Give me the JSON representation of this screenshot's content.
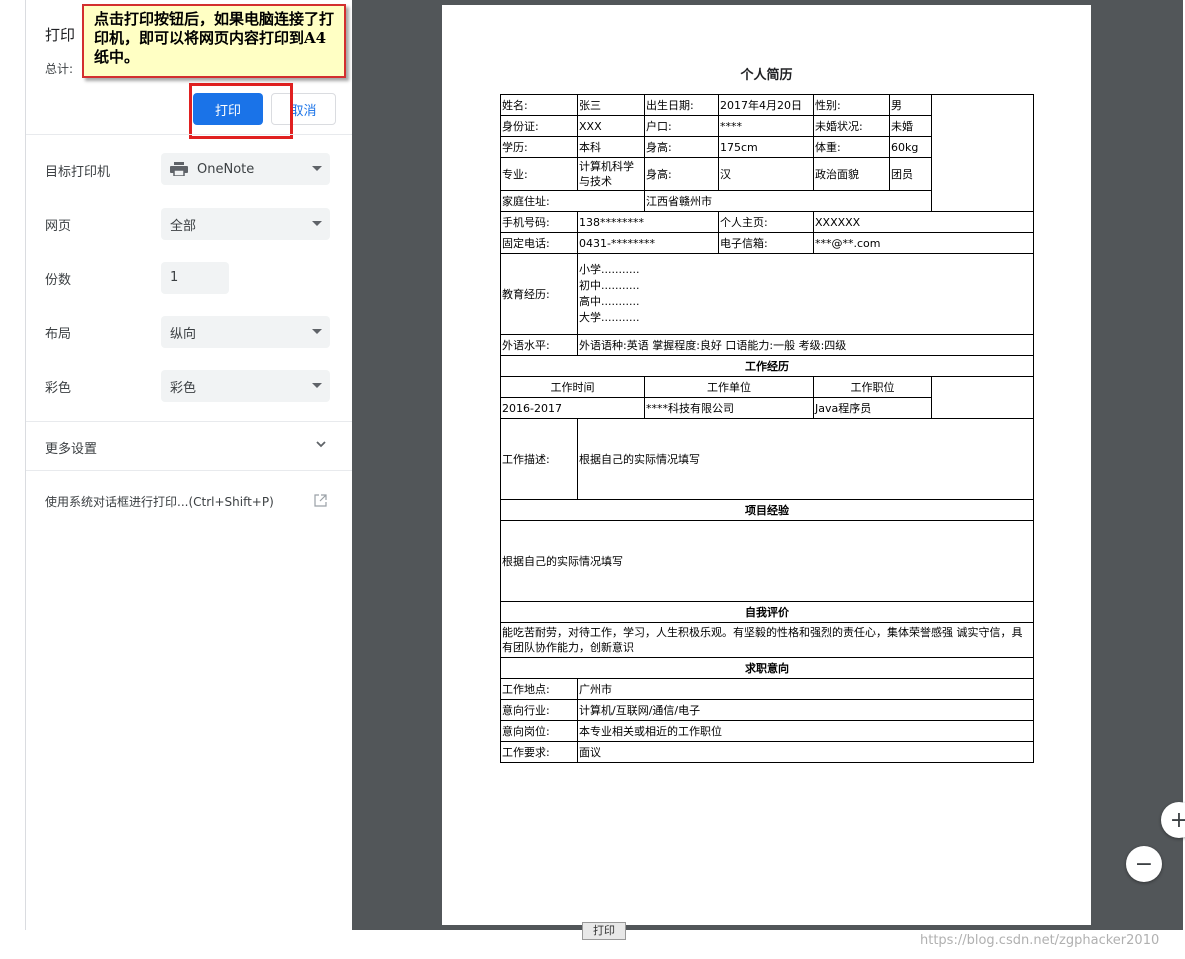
{
  "panel": {
    "title": "打印",
    "total_label": "总计:",
    "print_button": "打印",
    "cancel_button": "取消",
    "destination_label": "目标打印机",
    "destination_value": "OneNote",
    "pages_label": "网页",
    "pages_value": "全部",
    "copies_label": "份数",
    "copies_value": "1",
    "layout_label": "布局",
    "layout_value": "纵向",
    "color_label": "彩色",
    "color_value": "彩色",
    "more_settings": "更多设置",
    "system_dialog": "使用系统对话框进行打印...(Ctrl+Shift+P)"
  },
  "tooltip": {
    "text": "点击打印按钮后，如果电脑连接了打印机，即可以将网页内容打印到A4纸中。"
  },
  "resume": {
    "title": "个人简历",
    "name_label": "姓名:",
    "name": "张三",
    "birth_label": "出生日期:",
    "birth": "2017年4月20日",
    "gender_label": "性别:",
    "gender": "男",
    "id_label": "身份证:",
    "id": "XXX",
    "hukou_label": "户口:",
    "hukou": "****",
    "marital_label": "未婚状况:",
    "marital": "未婚",
    "edu_label": "学历:",
    "edu": "本科",
    "height_label": "身高:",
    "height": "175cm",
    "weight_label": "体重:",
    "weight": "60kg",
    "major_label": "专业:",
    "major": "计算机科学与技术",
    "nation_label": "身高:",
    "nation": "汉",
    "politics_label": "政治面貌",
    "politics": "团员",
    "address_label": "家庭住址:",
    "address": "江西省赣州市",
    "phone_label": "手机号码:",
    "phone": "138********",
    "homepage_label": "个人主页:",
    "homepage": "XXXXXX",
    "tel_label": "固定电话:",
    "tel": "0431-********",
    "email_label": "电子信箱:",
    "email": "***@**.com",
    "education_label": "教育经历:",
    "education": [
      "小学...........",
      "初中...........",
      "高中...........",
      "大学..........."
    ],
    "language_label": "外语水平:",
    "language": "外语语种:英语  掌握程度:良好  口语能力:一般  考级:四级",
    "work_header": "工作经历",
    "work_time_h": "工作时间",
    "work_unit_h": "工作单位",
    "work_pos_h": "工作职位",
    "work_time": "2016-2017",
    "work_unit": "****科技有限公司",
    "work_pos": "Java程序员",
    "work_desc_label": "工作描述:",
    "work_desc": "根据自己的实际情况填写",
    "project_header": "项目经验",
    "project": "根据自己的实际情况填写",
    "self_header": "自我评价",
    "self": "能吃苦耐劳，对待工作，学习，人生积极乐观。有坚毅的性格和强烈的责任心，集体荣誉感强 诚实守信，具有团队协作能力，创新意识",
    "intent_header": "求职意向",
    "loc_label": "工作地点:",
    "loc": "广州市",
    "industry_label": "意向行业:",
    "industry": "计算机/互联网/通信/电子",
    "post_label": "意向岗位:",
    "post": "本专业相关或相近的工作职位",
    "req_label": "工作要求:",
    "req": "面议"
  },
  "footer": {
    "print_label": "打印",
    "watermark": "https://blog.csdn.net/zgphacker2010"
  }
}
